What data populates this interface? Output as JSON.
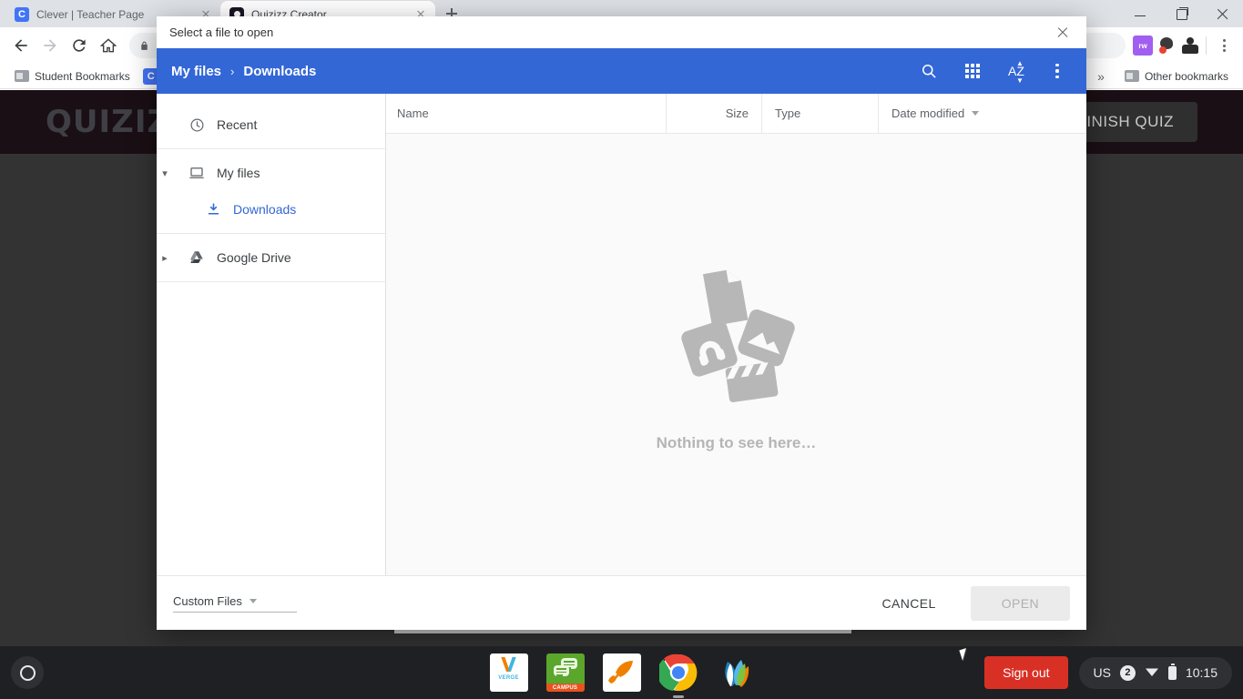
{
  "browser": {
    "tabs": [
      {
        "title": "Clever | Teacher Page",
        "favicon": "clever-icon",
        "active": false
      },
      {
        "title": "Quizizz Creator",
        "favicon": "quizizz-icon",
        "active": true
      }
    ],
    "new_tab_label": "+",
    "window_controls": {
      "minimize": "minimize-icon",
      "maximize": "maximize-icon",
      "close": "close-icon"
    },
    "toolbar": {
      "back": "back-arrow-icon",
      "forward": "forward-arrow-icon",
      "reload": "reload-icon",
      "home": "home-icon",
      "omnibox_value": "",
      "lock": "lock-icon",
      "extensions": [
        "read-write-extension-icon",
        "ink-blob-extension-icon",
        "person-extension-icon"
      ],
      "menu": "chrome-menu-icon"
    },
    "bookmarks": {
      "items": [
        {
          "label": "Student Bookmarks",
          "icon": "folder-icon"
        }
      ],
      "overflow_label": "»",
      "other_bookmarks_label": "Other bookmarks"
    }
  },
  "page": {
    "logo_text": "QUIZIZZ",
    "finish_quiz_label": "FINISH QUIZ"
  },
  "dialog": {
    "title": "Select a file to open",
    "close_icon": "close-icon",
    "breadcrumb": {
      "root": "My files",
      "separator": "›",
      "current": "Downloads"
    },
    "actions": {
      "search": "search-icon",
      "view_grid": "grid-view-icon",
      "sort_az": "sort-az-icon",
      "sort_az_label": "AZ",
      "more": "more-options-icon"
    },
    "sidebar": {
      "groups": [
        {
          "items": [
            {
              "label": "Recent",
              "icon": "clock-icon",
              "expander": "",
              "selected": false
            }
          ]
        },
        {
          "items": [
            {
              "label": "My files",
              "icon": "device-icon",
              "expander": "⌄",
              "selected": false
            },
            {
              "label": "Downloads",
              "icon": "download-icon",
              "expander": "",
              "selected": true
            }
          ]
        },
        {
          "items": [
            {
              "label": "Google Drive",
              "icon": "google-drive-icon",
              "expander": "›",
              "selected": false
            }
          ]
        }
      ]
    },
    "filelist": {
      "columns": {
        "name": "Name",
        "size": "Size",
        "type": "Type",
        "date_modified": "Date modified",
        "sort_caret": "caret-down-icon"
      },
      "rows": [],
      "empty_text": "Nothing to see here…",
      "empty_illustration": "empty-files-illustration"
    },
    "footer": {
      "filetype_value": "Custom Files",
      "filetype_caret": "caret-down-icon",
      "cancel_label": "CANCEL",
      "open_label": "OPEN"
    }
  },
  "shelf": {
    "launcher": "launcher-icon",
    "apps": [
      {
        "name": "verge-app",
        "label": "VERGE"
      },
      {
        "name": "campus-app",
        "label": "CAMPUS"
      },
      {
        "name": "rocket-app",
        "label": ""
      },
      {
        "name": "chrome-app",
        "label": ""
      },
      {
        "name": "leaf-app",
        "label": ""
      }
    ],
    "signout_label": "Sign out",
    "status": {
      "keyboard": "US",
      "notification_count": "2",
      "wifi": "wifi-icon",
      "battery": "battery-icon",
      "time": "10:15"
    }
  },
  "colors": {
    "dialog_accent": "#3367d6",
    "signout": "#d93025",
    "link": "#3367d6",
    "shelf": "#1f2023"
  }
}
